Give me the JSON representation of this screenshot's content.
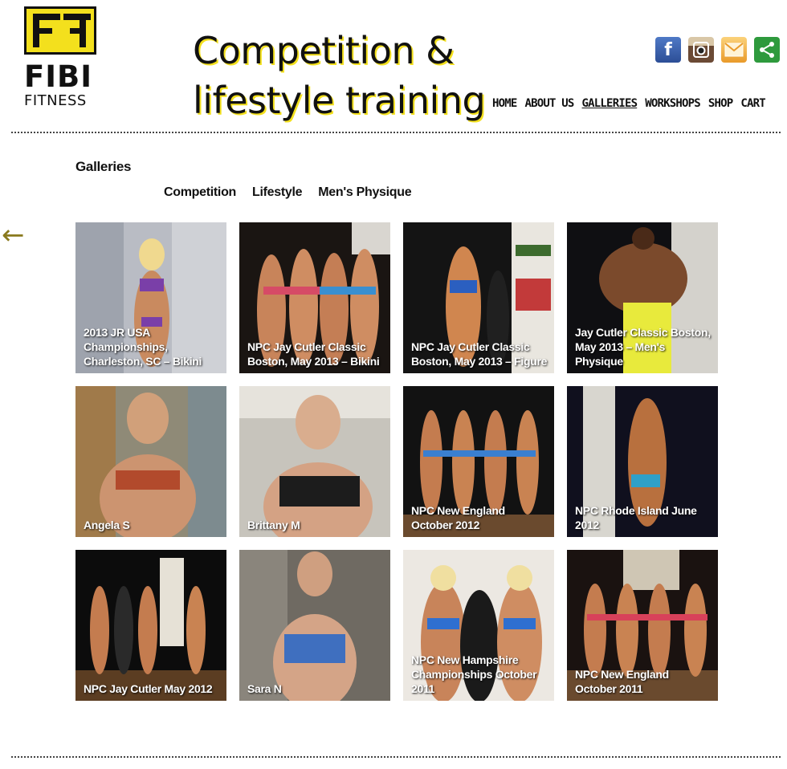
{
  "site": {
    "logo_text": "FIBI",
    "logo_sub": "FITNESS",
    "tagline_line1": "Competition &",
    "tagline_line2": "lifestyle training"
  },
  "social": {
    "icons": [
      "facebook-icon",
      "instagram-icon",
      "email-icon",
      "share-icon"
    ]
  },
  "nav": {
    "items": [
      {
        "label": "HOME"
      },
      {
        "label": "ABOUT US"
      },
      {
        "label": "GALLERIES",
        "active": true
      },
      {
        "label": "WORKSHOPS"
      },
      {
        "label": "SHOP"
      },
      {
        "label": "CART"
      }
    ]
  },
  "page": {
    "heading": "Galleries",
    "back_arrow": "←",
    "subnav": [
      {
        "label": "Competition"
      },
      {
        "label": "Lifestyle"
      },
      {
        "label": "Men's Physique"
      }
    ]
  },
  "galleries": [
    {
      "caption": "2013 JR USA Championships, Charleston, SC – Bikini"
    },
    {
      "caption": "NPC Jay Cutler Classic Boston, May 2013 – Bikini"
    },
    {
      "caption": "NPC Jay Cutler Classic Boston, May 2013 – Figure"
    },
    {
      "caption": "Jay Cutler Classic Boston, May 2013 – Men's Physique"
    },
    {
      "caption": "Angela S"
    },
    {
      "caption": "Brittany M"
    },
    {
      "caption": "NPC New England October 2012"
    },
    {
      "caption": "NPC Rhode Island June 2012"
    },
    {
      "caption": "NPC Jay Cutler May 2012"
    },
    {
      "caption": "Sara N"
    },
    {
      "caption": "NPC New Hampshire Championships October 2011"
    },
    {
      "caption": "NPC New England October 2011"
    }
  ],
  "colors": {
    "brand_yellow": "#f3e01d",
    "text": "#111111",
    "arrow": "#8a7a1e"
  }
}
